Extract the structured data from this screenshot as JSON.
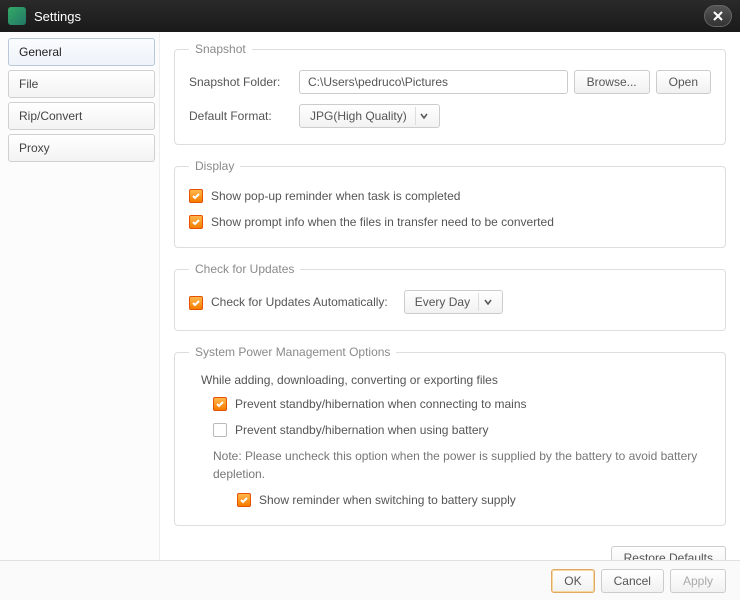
{
  "window": {
    "title": "Settings"
  },
  "sidebar": {
    "tabs": [
      {
        "label": "General"
      },
      {
        "label": "File"
      },
      {
        "label": "Rip/Convert"
      },
      {
        "label": "Proxy"
      }
    ]
  },
  "snapshot": {
    "legend": "Snapshot",
    "folder_label": "Snapshot Folder:",
    "folder_value": "C:\\Users\\pedruco\\Pictures",
    "browse": "Browse...",
    "open": "Open",
    "format_label": "Default Format:",
    "format_value": "JPG(High Quality)"
  },
  "display": {
    "legend": "Display",
    "popup": "Show pop-up reminder when task is completed",
    "prompt": "Show prompt info when the files in transfer need to be converted"
  },
  "updates": {
    "legend": "Check for Updates",
    "label": "Check for Updates Automatically:",
    "value": "Every Day"
  },
  "power": {
    "legend": "System Power Management Options",
    "subtitle": "While adding, downloading, converting or exporting files",
    "mains": "Prevent standby/hibernation when connecting to mains",
    "battery": "Prevent standby/hibernation when using battery",
    "note": "Note: Please uncheck this option when the power is supplied by the battery to avoid battery depletion.",
    "reminder": "Show reminder when switching to battery supply"
  },
  "buttons": {
    "restore": "Restore Defaults",
    "ok": "OK",
    "cancel": "Cancel",
    "apply": "Apply"
  }
}
